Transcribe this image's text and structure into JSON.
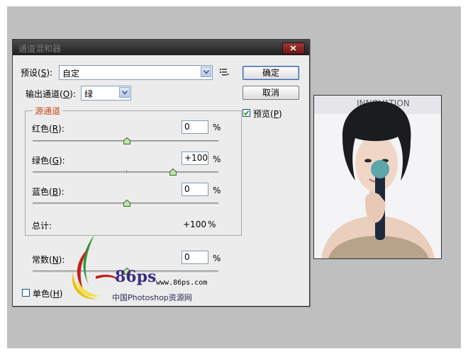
{
  "dialog": {
    "title": "通道混和器",
    "preset": {
      "label": "预设(",
      "key": "S",
      "suffix": "):",
      "value": "自定"
    },
    "output_channel": {
      "label": "输出通道(",
      "key": "O",
      "suffix": "):",
      "value": "绿"
    },
    "buttons": {
      "ok": "确定",
      "cancel": "取消"
    },
    "preview": {
      "label": "预览(",
      "key": "P",
      "suffix": ")",
      "checked": true
    },
    "source_group": {
      "title": "源通道",
      "red": {
        "label": "红色(",
        "key": "R",
        "suffix": "):",
        "value": "0",
        "unit": "%",
        "level": 0
      },
      "green": {
        "label": "绿色(",
        "key": "G",
        "suffix": "):",
        "value": "+100",
        "unit": "%",
        "level": 100
      },
      "blue": {
        "label": "蓝色(",
        "key": "B",
        "suffix": "):",
        "value": "0",
        "unit": "%",
        "level": 0
      },
      "total": {
        "label": "总计:",
        "value": "+100",
        "unit": "%"
      }
    },
    "constant": {
      "label": "常数(",
      "key": "N",
      "suffix": "):",
      "value": "0",
      "unit": "%",
      "level": 0
    },
    "monochrome": {
      "label": "单色(",
      "key": "H",
      "suffix": ")",
      "checked": false
    }
  },
  "watermark": {
    "brand": "86ps",
    "url": "www.86ps.com",
    "site_name": "中国Photoshop资源网"
  },
  "colors": {
    "canvas": "#bfbfbf",
    "dialog": "#ececec",
    "group_title": "#c34b1d"
  }
}
